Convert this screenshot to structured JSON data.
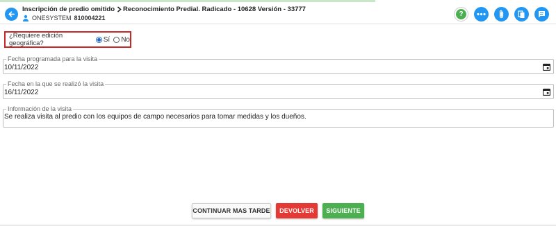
{
  "header": {
    "breadcrumb_1": "Inscripción de predio omitido",
    "breadcrumb_2": "Reconocimiento Predial. Radicado - 10628 Versión - 33777",
    "user_name": "ONESYSTEM",
    "user_id": "810004221",
    "icons": [
      "back-arrow-icon",
      "chevron-right-icon",
      "user-icon",
      "help-icon",
      "more-dots-icon",
      "attachment-icon",
      "copy-document-icon",
      "comments-icon"
    ],
    "help_glyph": "?"
  },
  "geo": {
    "question": "¿Requiere edición geográfica?",
    "option_yes": "Sí",
    "option_no": "No",
    "selected": "Sí"
  },
  "fields": {
    "scheduled": {
      "label": "Fecha programada para la visita",
      "value": "10/11/2022"
    },
    "performed": {
      "label": "Fecha en la que se realizó la visita",
      "value": "16/11/2022"
    },
    "info": {
      "label": "Información de la visita",
      "value": "Se realiza visita al predio con los equipos de campo necesarios para tomar medidas y los dueños."
    }
  },
  "buttons": {
    "later": "CONTINUAR MAS TARDE",
    "back": "DEVOLVER",
    "next": "SIGUIENTE"
  },
  "colors": {
    "accent_blue": "#2196f3",
    "highlight_red": "#c62828",
    "devolver_red": "#e53935",
    "siguiente_green": "#4caf50",
    "help_green": "#4caf50"
  }
}
